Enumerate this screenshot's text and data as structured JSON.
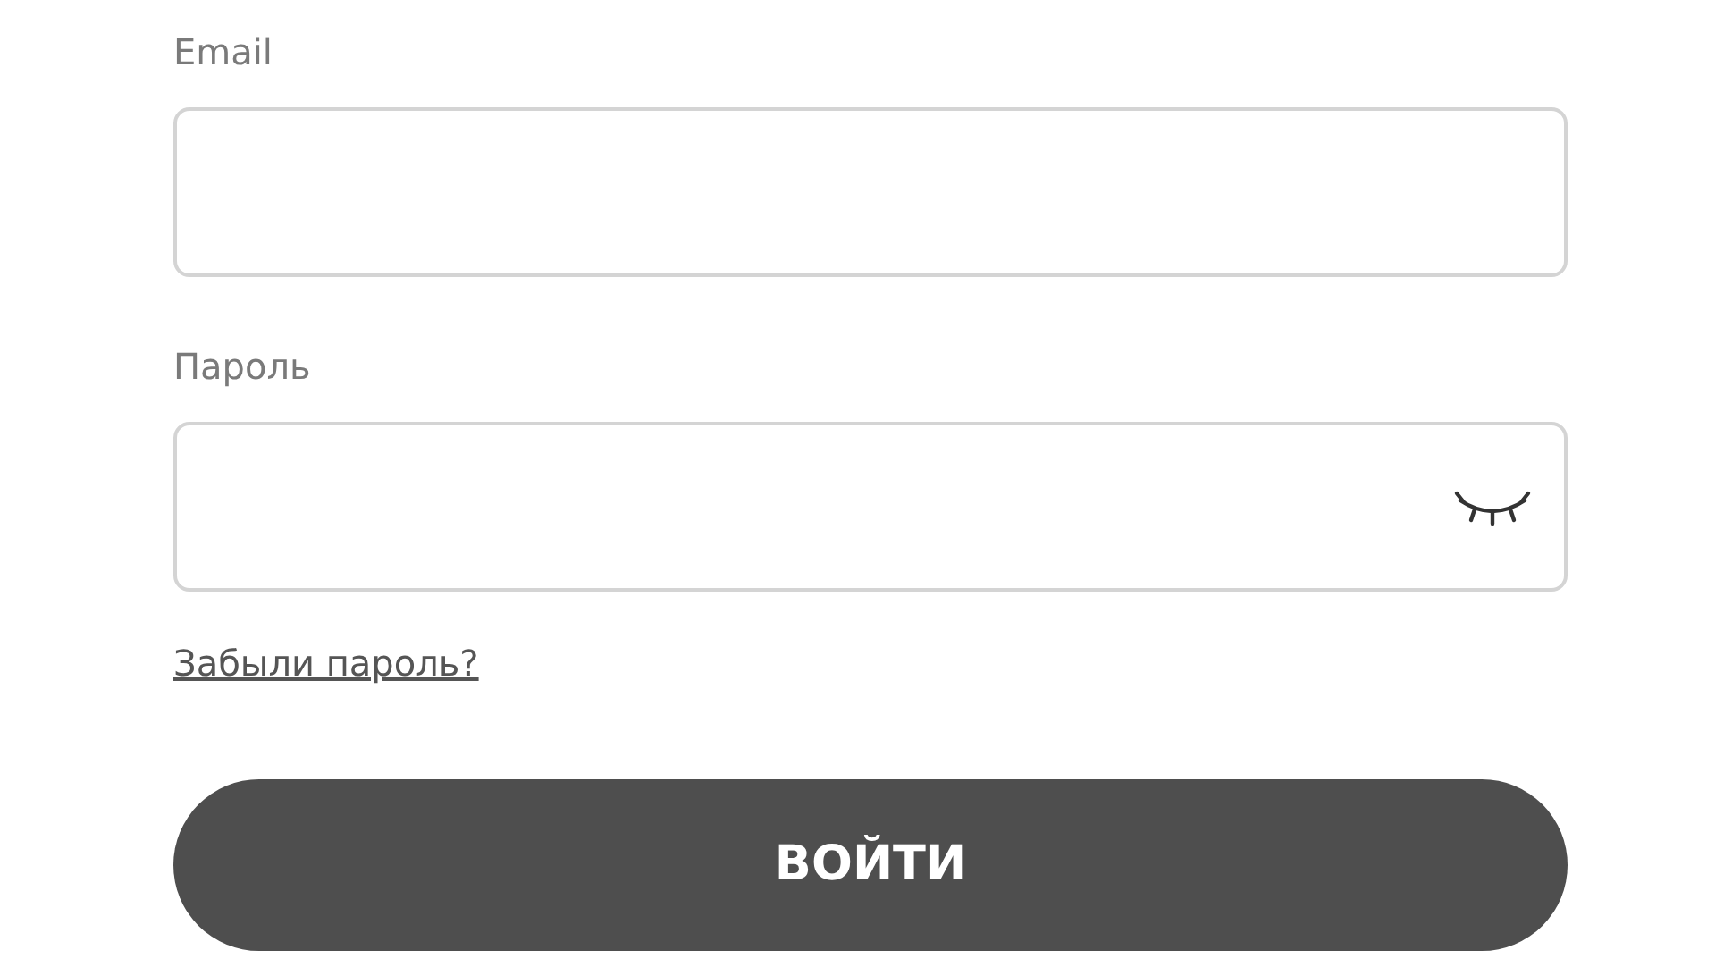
{
  "fields": [
    {
      "label": "Email",
      "kind": "email"
    },
    {
      "label": "Пароль",
      "kind": "password",
      "revealed": false
    }
  ],
  "forgot_link": "Забыли пароль?",
  "submit_button": "ВОЙТИ"
}
